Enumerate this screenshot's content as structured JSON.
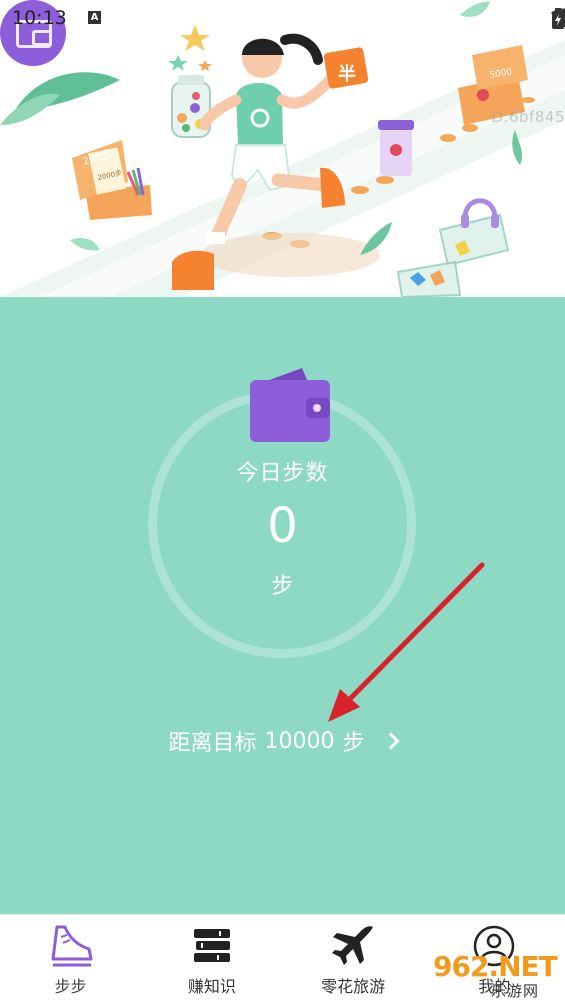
{
  "status_bar": {
    "time": "10:13",
    "keyboard_indicator": "A",
    "icons": [
      "vibrate-icon",
      "wifi-icon",
      "signal-icon",
      "battery-charging-icon"
    ]
  },
  "hero": {
    "overlay_id_text": "D:6bf845",
    "illustration_texts": {
      "box_left_lid": "200步",
      "box_left_note": "2000步",
      "box_right_lid": "5000",
      "sign_char": "半"
    }
  },
  "main": {
    "today_label": "今日步数",
    "step_count": "0",
    "step_unit": "步",
    "goal": {
      "prefix": "距离目标",
      "value": "10000",
      "suffix": "步"
    },
    "accent_color": "#8dd9c4",
    "wallet_color": "#8d5ed9"
  },
  "bottom_nav": {
    "items": [
      {
        "label": "步步",
        "icon": "sneaker-icon",
        "active": true
      },
      {
        "label": "赚知识",
        "icon": "books-icon",
        "active": false
      },
      {
        "label": "零花旅游",
        "icon": "airplane-icon",
        "active": false
      },
      {
        "label": "我的",
        "icon": "user-icon",
        "active": false
      }
    ]
  },
  "watermark": {
    "number": "962.NET",
    "name": "乐游网"
  }
}
